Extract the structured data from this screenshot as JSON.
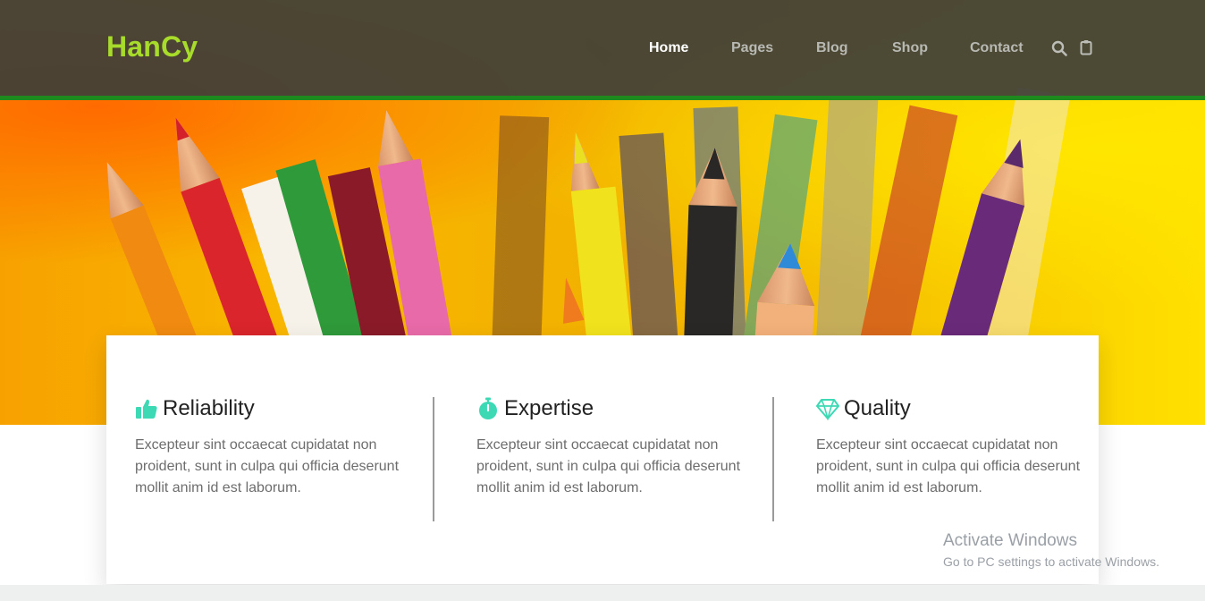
{
  "header": {
    "logo": "HanCy",
    "nav": [
      {
        "label": "Home",
        "active": true
      },
      {
        "label": "Pages",
        "active": false
      },
      {
        "label": "Blog",
        "active": false
      },
      {
        "label": "Shop",
        "active": false
      },
      {
        "label": "Contact",
        "active": false
      }
    ],
    "icons": [
      "search-icon",
      "clipboard-cart-icon"
    ]
  },
  "hero": {
    "image": "colored-pencils"
  },
  "features": [
    {
      "icon": "thumbs-up-icon",
      "title": "Reliability",
      "text": "Excepteur sint occaecat cupidatat non proident, sunt in culpa qui officia deserunt mollit anim id est laborum."
    },
    {
      "icon": "stopwatch-icon",
      "title": "Expertise",
      "text": "Excepteur sint occaecat cupidatat non proident, sunt in culpa qui officia deserunt mollit anim id est laborum."
    },
    {
      "icon": "diamond-icon",
      "title": "Quality",
      "text": "Excepteur sint occaecat cupidatat non proident, sunt in culpa qui officia deserunt mollit anim id est laborum."
    }
  ],
  "watermark": {
    "title": "Activate Windows",
    "subtitle": "Go to PC settings to activate Windows."
  },
  "colors": {
    "logo": "#a8dc2a",
    "header_bg": "#3e3e38",
    "header_border": "#1e8a1e",
    "accent_icon": "#3dd9b5"
  }
}
